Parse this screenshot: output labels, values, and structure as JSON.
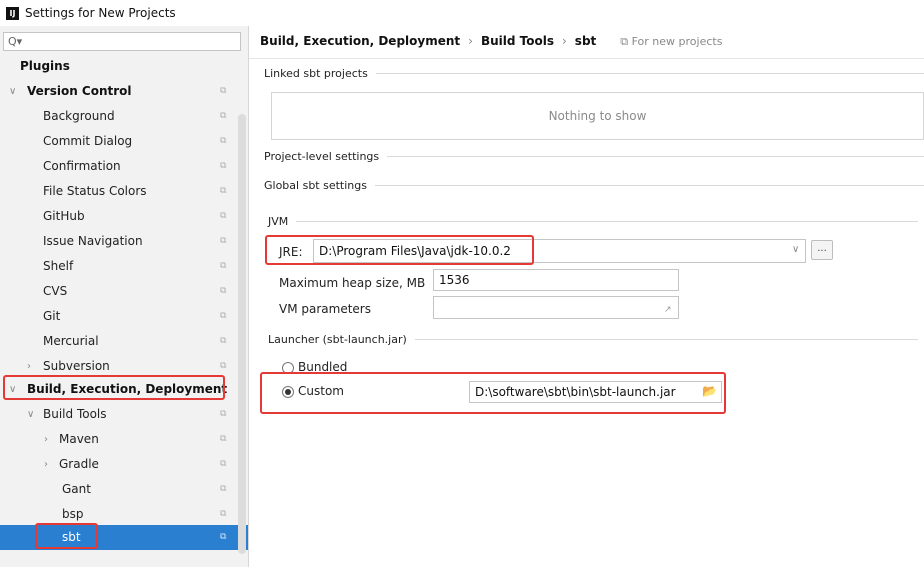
{
  "window": {
    "title": "Settings for New Projects",
    "app_icon": "IJ"
  },
  "sidebar": {
    "search_text": "Q▾",
    "items": [
      {
        "label": "Plugins",
        "arrow": "",
        "copy": ""
      },
      {
        "label": "Version Control",
        "arrow": "∨",
        "copy": "⧉"
      },
      {
        "label": "Background",
        "arrow": "",
        "copy": "⧉"
      },
      {
        "label": "Commit Dialog",
        "arrow": "",
        "copy": "⧉"
      },
      {
        "label": "Confirmation",
        "arrow": "",
        "copy": "⧉"
      },
      {
        "label": "File Status Colors",
        "arrow": "",
        "copy": "⧉"
      },
      {
        "label": "GitHub",
        "arrow": "",
        "copy": "⧉"
      },
      {
        "label": "Issue Navigation",
        "arrow": "",
        "copy": "⧉"
      },
      {
        "label": "Shelf",
        "arrow": "",
        "copy": "⧉"
      },
      {
        "label": "CVS",
        "arrow": "",
        "copy": "⧉"
      },
      {
        "label": "Git",
        "arrow": "",
        "copy": "⧉"
      },
      {
        "label": "Mercurial",
        "arrow": "",
        "copy": "⧉"
      },
      {
        "label": "Subversion",
        "arrow": "›",
        "copy": "⧉"
      },
      {
        "label": "Build, Execution, Deployment",
        "arrow": "∨",
        "copy": ""
      },
      {
        "label": "Build Tools",
        "arrow": "∨",
        "copy": "⧉"
      },
      {
        "label": "Maven",
        "arrow": "›",
        "copy": "⧉"
      },
      {
        "label": "Gradle",
        "arrow": "›",
        "copy": "⧉"
      },
      {
        "label": "Gant",
        "arrow": "",
        "copy": "⧉"
      },
      {
        "label": "bsp",
        "arrow": "",
        "copy": "⧉"
      },
      {
        "label": "sbt",
        "arrow": "",
        "copy": "⧉"
      }
    ]
  },
  "breadcrumb": {
    "part1": "Build, Execution, Deployment",
    "sep1": "›",
    "part2": "Build Tools",
    "sep2": "›",
    "part3": "sbt",
    "note": "⧉ For new projects"
  },
  "sections": {
    "linked": "Linked sbt projects",
    "empty_text": "Nothing to show",
    "project_level": "Project-level settings",
    "global": "Global sbt settings",
    "jvm": "JVM",
    "launcher": "Launcher (sbt-launch.jar)"
  },
  "jvm": {
    "jre_label": "JRE:",
    "jre_value": "D:\\Program Files\\Java\\jdk-10.0.2",
    "dropdown_arrow": "∨",
    "browse_label": "...",
    "heap_label": "Maximum heap size, MB",
    "heap_value": "1536",
    "vm_label": "VM parameters",
    "vm_value": "",
    "expand_glyph": "↗"
  },
  "launcher": {
    "bundled_label": "Bundled",
    "custom_label": "Custom",
    "custom_path": "D:\\software\\sbt\\bin\\sbt-launch.jar",
    "folder_glyph": "📂",
    "selected": "Custom"
  }
}
